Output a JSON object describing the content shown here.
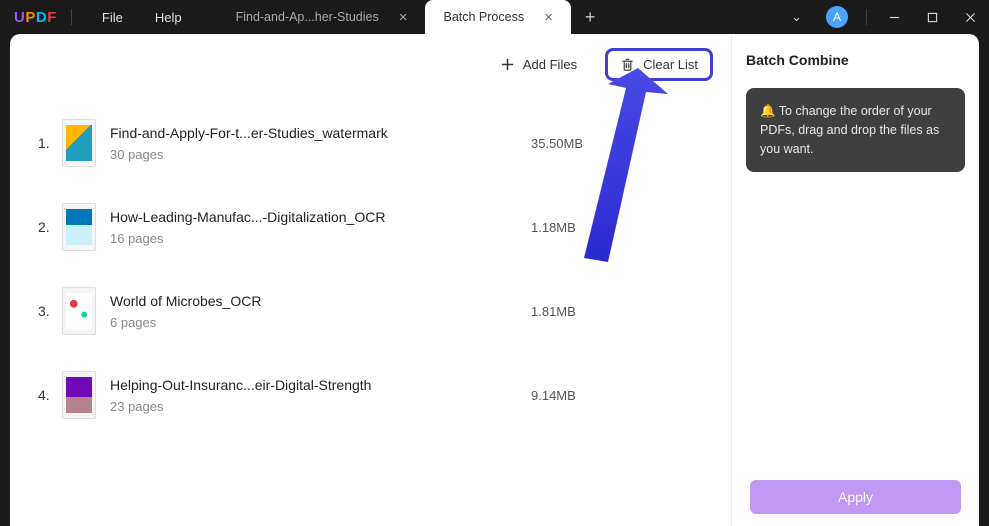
{
  "app": {
    "logo": "UPDF"
  },
  "menu": {
    "file": "File",
    "help": "Help"
  },
  "tabs": {
    "inactive": {
      "label": "Find-and-Ap...her-Studies"
    },
    "active": {
      "label": "Batch Process"
    }
  },
  "avatar": "A",
  "toolbar": {
    "add_files": "Add Files",
    "clear_list": "Clear List"
  },
  "files": [
    {
      "num": "1.",
      "name": "Find-and-Apply-For-t...er-Studies_watermark",
      "pages": "30 pages",
      "size": "35.50MB"
    },
    {
      "num": "2.",
      "name": "How-Leading-Manufac...-Digitalization_OCR",
      "pages": "16 pages",
      "size": "1.18MB"
    },
    {
      "num": "3.",
      "name": "World of Microbes_OCR",
      "pages": "6 pages",
      "size": "1.81MB"
    },
    {
      "num": "4.",
      "name": "Helping-Out-Insuranc...eir-Digital-Strength",
      "pages": "23 pages",
      "size": "9.14MB"
    }
  ],
  "sidebar": {
    "title": "Batch Combine",
    "tip": "🔔 To change the order of your PDFs, drag and drop the files as you want.",
    "apply": "Apply"
  }
}
